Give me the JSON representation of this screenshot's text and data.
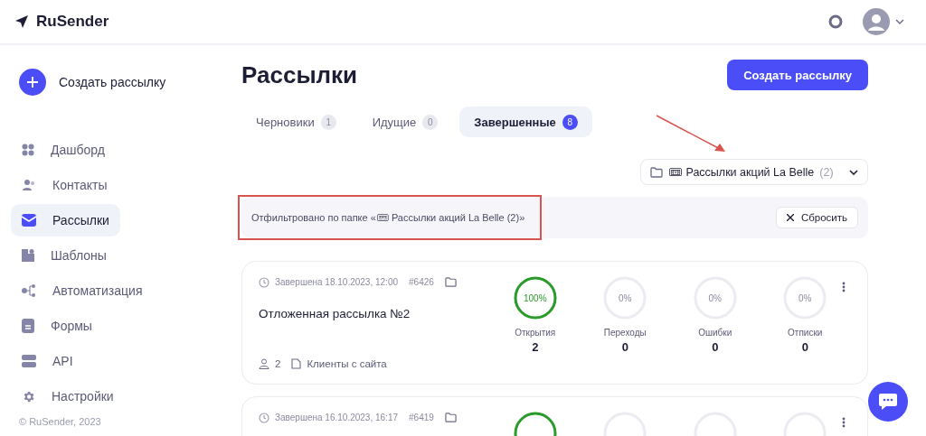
{
  "brand": "RuSender",
  "sidebar": {
    "create_label": "Создать рассылку",
    "items": [
      {
        "label": "Дашборд",
        "selected": false
      },
      {
        "label": "Контакты",
        "selected": false
      },
      {
        "label": "Рассылки",
        "selected": true
      },
      {
        "label": "Шаблоны",
        "selected": false
      },
      {
        "label": "Автоматизация",
        "selected": false
      },
      {
        "label": "Формы",
        "selected": false
      },
      {
        "label": "API",
        "selected": false
      },
      {
        "label": "Настройки",
        "selected": false
      }
    ],
    "footer": "© RuSender, 2023"
  },
  "page": {
    "title": "Рассылки",
    "create_button": "Создать рассылку"
  },
  "tabs": [
    {
      "label": "Черновики",
      "count": "1",
      "selected": false
    },
    {
      "label": "Идущие",
      "count": "0",
      "selected": false
    },
    {
      "label": "Завершенные",
      "count": "8",
      "selected": true
    }
  ],
  "folder_select": {
    "emoji": "🎟",
    "label": "Рассылки акций La Belle",
    "count": "(2)"
  },
  "filter_bar": {
    "text": "Отфильтровано по папке «🎟 Рассылки акций La Belle (2)»",
    "reset_button": "Сбросить"
  },
  "campaigns": [
    {
      "status": "Завершена 18.10.2023, 12:00",
      "id": "#6426",
      "title": "Отложенная рассылка №2",
      "recipients": "2",
      "list": "Клиенты с сайта",
      "stats": [
        {
          "percent": "100%",
          "active": true,
          "label": "Открытия",
          "value": "2"
        },
        {
          "percent": "0%",
          "active": false,
          "label": "Переходы",
          "value": "0"
        },
        {
          "percent": "0%",
          "active": false,
          "label": "Ошибки",
          "value": "0"
        },
        {
          "percent": "0%",
          "active": false,
          "label": "Отписки",
          "value": "0"
        }
      ]
    },
    {
      "status": "Завершена 16.10.2023, 16:17",
      "id": "#6419",
      "stats": [
        {
          "active": true
        },
        {
          "active": false
        },
        {
          "active": false
        },
        {
          "active": false
        }
      ]
    }
  ]
}
